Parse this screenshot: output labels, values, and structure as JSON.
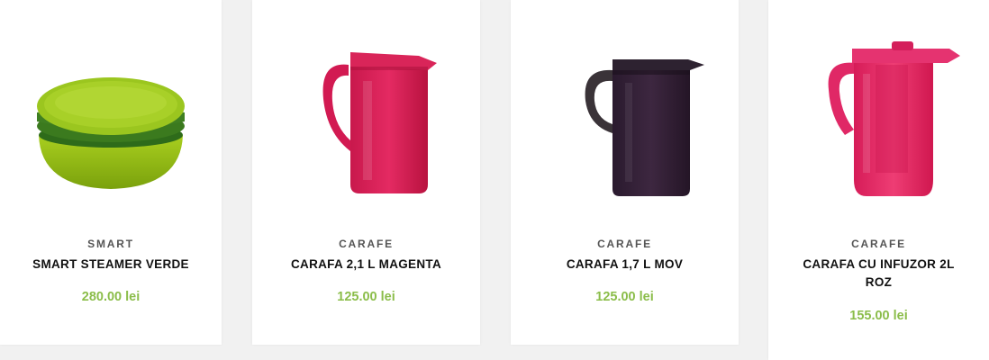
{
  "products": [
    {
      "category": "SMART",
      "title": "SMART STEAMER VERDE",
      "price": "280.00 lei",
      "image_icon": "green-steamer-bowl-icon"
    },
    {
      "category": "CARAFE",
      "title": "CARAFA 2,1 L MAGENTA",
      "price": "125.00 lei",
      "image_icon": "magenta-pitcher-icon"
    },
    {
      "category": "CARAFE",
      "title": "CARAFA 1,7 L MOV",
      "price": "125.00 lei",
      "image_icon": "purple-pitcher-icon"
    },
    {
      "category": "CARAFE",
      "title": "CARAFA CU INFUZOR 2L ROZ",
      "price": "155.00 lei",
      "image_icon": "pink-infuser-pitcher-icon"
    }
  ],
  "colors": {
    "price": "#8bbd4a",
    "category": "#555555",
    "title": "#111111",
    "background": "#f1f1f1",
    "card": "#ffffff"
  }
}
